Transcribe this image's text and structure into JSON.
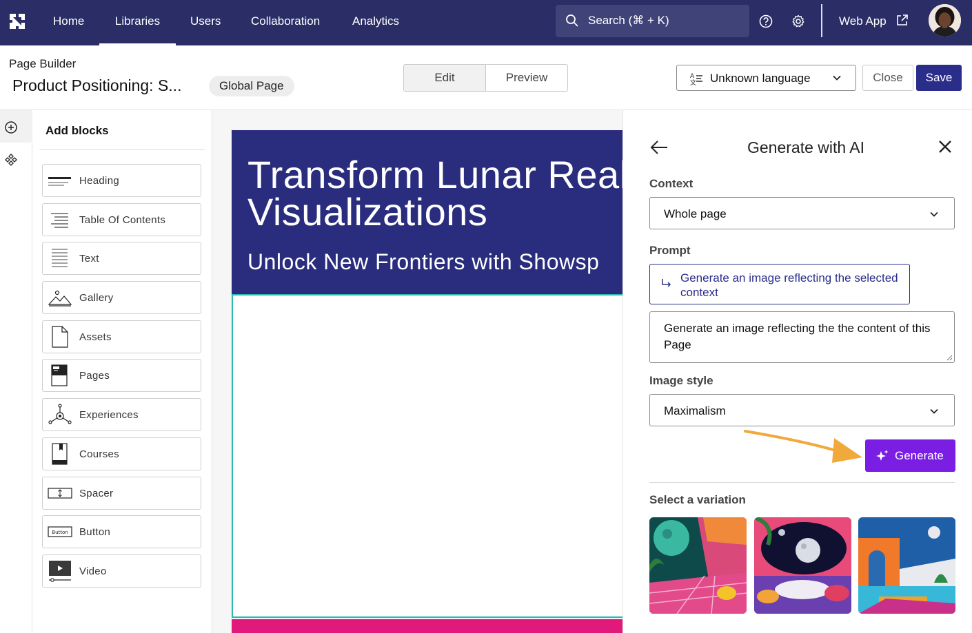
{
  "nav": {
    "items": [
      {
        "label": "Home"
      },
      {
        "label": "Libraries"
      },
      {
        "label": "Users"
      },
      {
        "label": "Collaboration"
      },
      {
        "label": "Analytics"
      }
    ],
    "active": "Libraries",
    "search_placeholder": "Search (⌘ + K)",
    "web_app_label": "Web App",
    "icons": [
      "logo-icon",
      "search-icon",
      "help-icon",
      "gear-icon",
      "external-link-icon"
    ]
  },
  "header": {
    "breadcrumb": "Page Builder",
    "title": "Product Positioning: S...",
    "badge": "Global Page",
    "mode_tabs": [
      "Edit",
      "Preview"
    ],
    "active_mode": "Edit",
    "language": "Unknown language",
    "close_label": "Close",
    "save_label": "Save"
  },
  "blocks_panel": {
    "title": "Add blocks",
    "items": [
      {
        "label": "Heading",
        "icon": "heading-icon"
      },
      {
        "label": "Table Of Contents",
        "icon": "table-of-contents-icon"
      },
      {
        "label": "Text",
        "icon": "text-icon"
      },
      {
        "label": "Gallery",
        "icon": "gallery-icon"
      },
      {
        "label": "Assets",
        "icon": "assets-icon"
      },
      {
        "label": "Pages",
        "icon": "pages-icon"
      },
      {
        "label": "Experiences",
        "icon": "experiences-icon"
      },
      {
        "label": "Courses",
        "icon": "courses-icon"
      },
      {
        "label": "Spacer",
        "icon": "spacer-icon"
      },
      {
        "label": "Button",
        "icon": "button-block-icon",
        "icon_text": "Button"
      },
      {
        "label": "Video",
        "icon": "video-icon"
      }
    ]
  },
  "canvas": {
    "hero_title_line1": "Transform Lunar Real",
    "hero_title_line2": "Visualizations",
    "hero_subtitle": "Unlock New Frontiers with Showsp",
    "hero_color": "#2a2c7e",
    "selected_outline_color": "#2ab8b0",
    "footer_strip_color": "#e0197a"
  },
  "ai_panel": {
    "title": "Generate with AI",
    "context_label": "Context",
    "context_value": "Whole page",
    "prompt_label": "Prompt",
    "prompt_suggestion": "Generate an image reflecting the selected context",
    "prompt_value": "Generate an image reflecting the the content of this Page",
    "image_style_label": "Image style",
    "image_style_value": "Maximalism",
    "generate_label": "Generate",
    "generate_color": "#7a1ee3",
    "variations_label": "Select a variation",
    "variations": [
      {
        "name": "variation-1",
        "description": "retro lunar corridor"
      },
      {
        "name": "variation-2",
        "description": "lunar lounge"
      },
      {
        "name": "variation-3",
        "description": "lunar pool terrace"
      }
    ]
  },
  "colors": {
    "nav_bg": "#2a2d66",
    "save_bg": "#2a2d8a",
    "annotation_arrow": "#f2a93b"
  }
}
